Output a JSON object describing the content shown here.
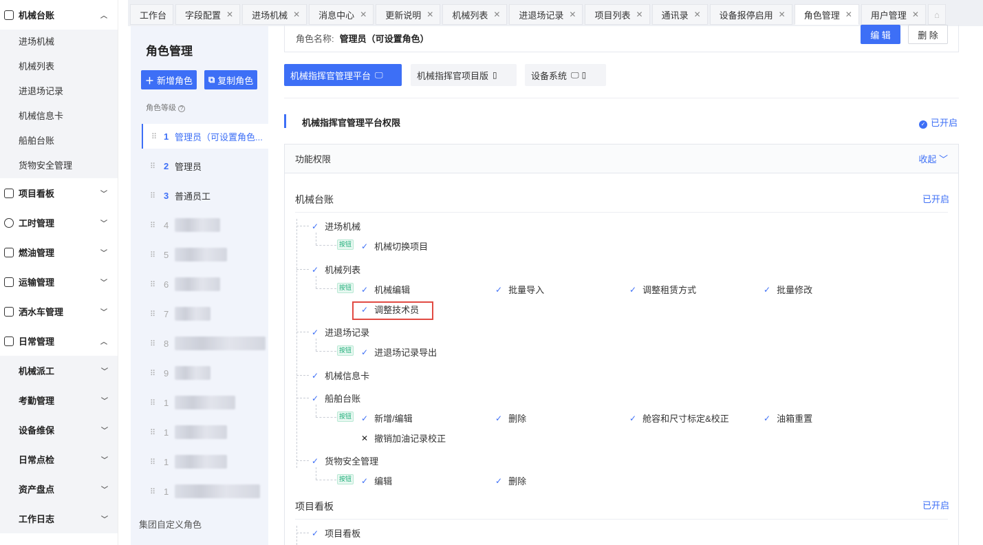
{
  "nav": {
    "groups": [
      {
        "label": "机械台账",
        "chev": "︿",
        "subs": [
          "进场机械",
          "机械列表",
          "进退场记录",
          "机械信息卡",
          "船舶台账",
          "货物安全管理"
        ]
      },
      {
        "label": "项目看板",
        "chev": "﹀"
      },
      {
        "label": "工时管理",
        "chev": "﹀"
      },
      {
        "label": "燃油管理",
        "chev": "﹀"
      },
      {
        "label": "运输管理",
        "chev": "﹀"
      },
      {
        "label": "洒水车管理",
        "chev": "﹀"
      },
      {
        "label": "日常管理",
        "chev": "︿",
        "subs2": [
          "机械派工",
          "考勤管理",
          "设备维保",
          "日常点检",
          "资产盘点",
          "工作日志"
        ]
      }
    ]
  },
  "tabs": [
    {
      "label": "工作台",
      "close": false
    },
    {
      "label": "字段配置",
      "close": true
    },
    {
      "label": "进场机械",
      "close": true
    },
    {
      "label": "消息中心",
      "close": true
    },
    {
      "label": "更新说明",
      "close": true
    },
    {
      "label": "机械列表",
      "close": true
    },
    {
      "label": "进退场记录",
      "close": true
    },
    {
      "label": "项目列表",
      "close": true
    },
    {
      "label": "通讯录",
      "close": true
    },
    {
      "label": "设备报停启用",
      "close": true
    },
    {
      "label": "角色管理",
      "close": true,
      "active": true
    },
    {
      "label": "用户管理",
      "close": true
    }
  ],
  "rolepanel": {
    "title": "角色管理",
    "add_label": "新增角色",
    "copy_label": "复制角色",
    "level_label": "角色等级",
    "roles": [
      {
        "num": "1",
        "name": "管理员（可设置角色..."
      },
      {
        "num": "2",
        "name": "管理员"
      },
      {
        "num": "3",
        "name": "普通员工"
      },
      {
        "num": "4"
      },
      {
        "num": "5"
      },
      {
        "num": "6"
      },
      {
        "num": "7"
      },
      {
        "num": "8"
      },
      {
        "num": "9"
      },
      {
        "num": "1"
      },
      {
        "num": "1"
      },
      {
        "num": "1"
      },
      {
        "num": "1"
      }
    ],
    "custom_label": "集团自定义角色"
  },
  "main": {
    "role_name_key": "角色名称:",
    "role_name_value": "管理员（可设置角色）",
    "edit_label": "编 辑",
    "delete_label": "删 除",
    "platform_tabs": [
      "机械指挥官管理平台",
      "机械指挥官项目版",
      "设备系统"
    ],
    "section_title": "机械指挥官管理平台权限",
    "section_status": "已开启",
    "func_title": "功能权限",
    "collapse_label": "收起",
    "btn_tag": "按钮",
    "module1": {
      "title": "机械台账",
      "status": "已开启",
      "items": {
        "i1": "进场机械",
        "i1b": [
          "机械切换项目"
        ],
        "i2": "机械列表",
        "i2b": [
          "机械编辑",
          "批量导入",
          "调整租赁方式",
          "批量修改",
          "调整技术员"
        ],
        "i3": "进退场记录",
        "i3b": [
          "进退场记录导出"
        ],
        "i4": "机械信息卡",
        "i5": "船舶台账",
        "i5b": [
          "新增/编辑",
          "删除",
          "舱容和尺寸标定&校正",
          "油箱重置",
          "撤销加油记录校正"
        ],
        "i6": "货物安全管理",
        "i6b": [
          "编辑",
          "删除"
        ]
      }
    },
    "module2": {
      "title": "项目看板",
      "status": "已开启",
      "items": {
        "i1": "项目看板"
      }
    }
  }
}
